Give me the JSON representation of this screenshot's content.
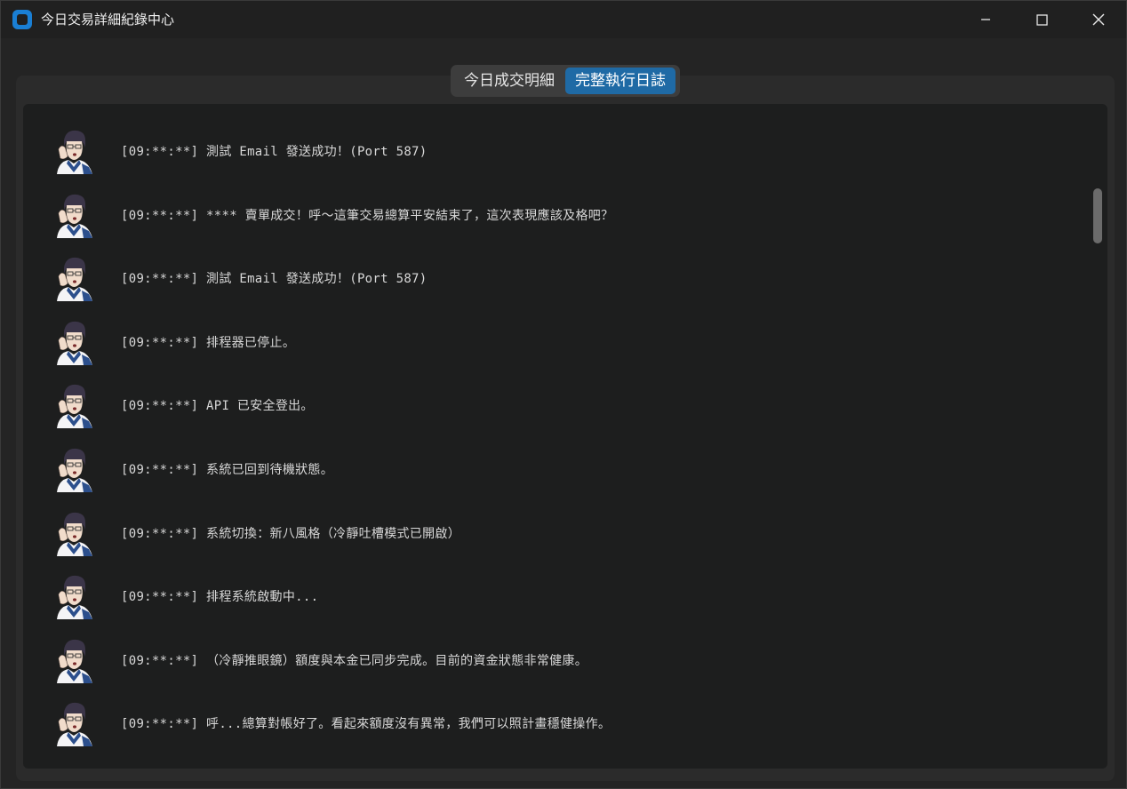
{
  "window": {
    "title": "今日交易詳細紀錄中心"
  },
  "tabs": [
    {
      "label": "今日成交明細",
      "active": false
    },
    {
      "label": "完整執行日誌",
      "active": true
    }
  ],
  "log": {
    "avatar_icon": "anime-character-avatar-icon",
    "entries": [
      {
        "text": "[09:**:**] 測試 Email 發送成功！(Port 587)"
      },
      {
        "text": "[09:**:**] **** 賣單成交！呼～這筆交易總算平安結束了，這次表現應該及格吧？"
      },
      {
        "text": "[09:**:**] 測試 Email 發送成功！(Port 587)"
      },
      {
        "text": "[09:**:**] 排程器已停止。"
      },
      {
        "text": "[09:**:**] API 已安全登出。"
      },
      {
        "text": "[09:**:**] 系統已回到待機狀態。"
      },
      {
        "text": "[09:**:**] 系統切換：新八風格（冷靜吐槽模式已開啟）"
      },
      {
        "text": "[09:**:**] 排程系統啟動中..."
      },
      {
        "text": "[09:**:**] （冷靜推眼鏡）額度與本金已同步完成。目前的資金狀態非常健康。"
      },
      {
        "text": "[09:**:**] 呼...總算對帳好了。看起來額度沒有異常，我們可以照計畫穩健操作。"
      }
    ]
  },
  "colors": {
    "accent": "#1f6aa5",
    "background": "#242424",
    "log_background": "#1d1e1e",
    "text": "#d8d8d8"
  }
}
